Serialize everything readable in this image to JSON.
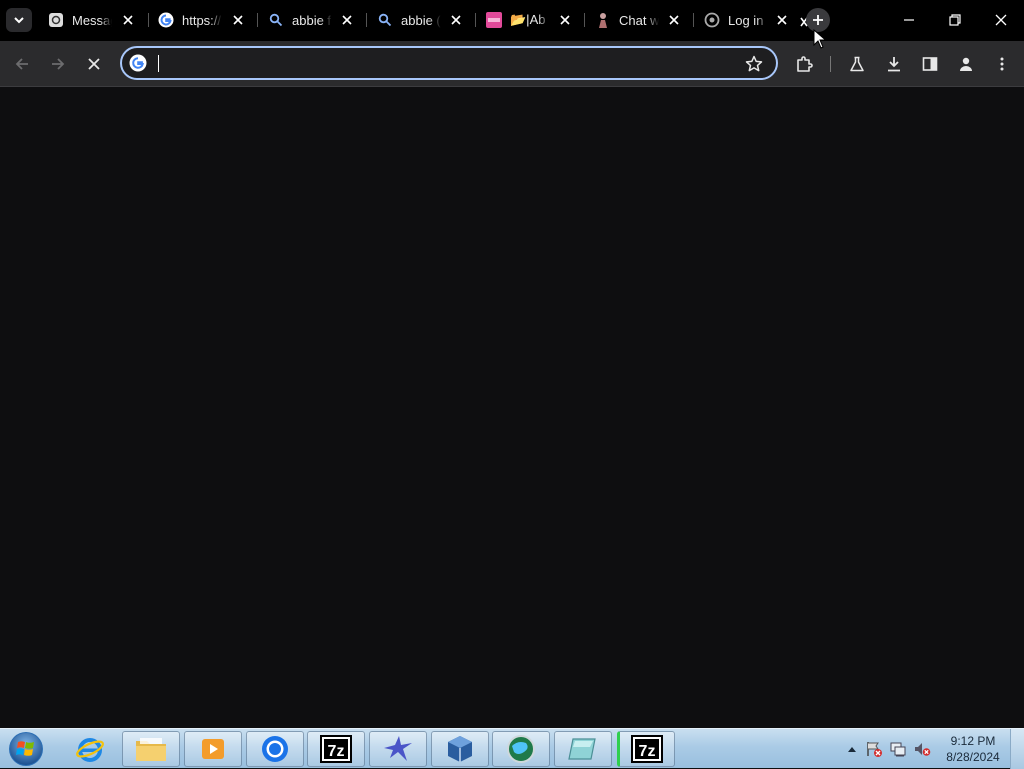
{
  "browser": {
    "tabs": [
      {
        "title": "Messag",
        "icon": "message-icon"
      },
      {
        "title": "https://",
        "icon": "google-icon"
      },
      {
        "title": "abbie f",
        "icon": "search-icon"
      },
      {
        "title": "abbie (",
        "icon": "search-icon"
      },
      {
        "title": "📂|Ab",
        "icon": "pink-site-icon"
      },
      {
        "title": "Chat w",
        "icon": "figure-icon"
      },
      {
        "title": "Log in",
        "icon": "circle-site-icon"
      }
    ],
    "omnibox": {
      "value": "",
      "placeholder": ""
    },
    "accent": "#a8c7fa"
  },
  "taskbar": {
    "apps": [
      "internet-explorer-icon",
      "file-explorer-icon",
      "media-player-icon",
      "chrome-icon",
      "7zip-icon",
      "bird-app-icon",
      "virtualbox-icon",
      "globe-app-icon",
      "tile-app-icon",
      "7zip-icon"
    ],
    "clock": {
      "time": "9:12 PM",
      "date": "8/28/2024"
    }
  }
}
